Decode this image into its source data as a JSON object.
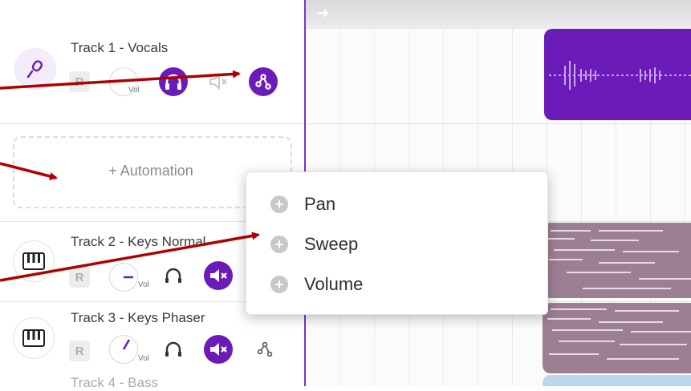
{
  "colors": {
    "accent": "#6a1bb8",
    "vocals_clip": "#6a1bb8",
    "keys_clip": "#9d7f94",
    "annotation_arrow": "#b00000"
  },
  "header": {
    "arrow_icon": "arrow-right-icon"
  },
  "tracks": [
    {
      "name": "Track 1 - Vocals",
      "icon": "microphone-icon",
      "record_label": "R",
      "vol_label": "Vol",
      "headphones_on": true,
      "muted": false,
      "automation_active": true
    },
    {
      "name": "Track 2 - Keys Normal",
      "icon": "piano-keys-icon",
      "record_label": "R",
      "vol_label": "Vol",
      "headphones_on": false,
      "muted": true,
      "automation_active": false
    },
    {
      "name": "Track 3 - Keys Phaser",
      "icon": "piano-keys-icon",
      "record_label": "R",
      "vol_label": "Vol",
      "headphones_on": false,
      "muted": true,
      "automation_active": false
    },
    {
      "name": "Track 4 - Bass"
    }
  ],
  "automation": {
    "add_label": "+ Automation"
  },
  "automation_menu": {
    "items": [
      {
        "label": "Pan",
        "icon": "plus-circle-icon"
      },
      {
        "label": "Sweep",
        "icon": "plus-circle-icon"
      },
      {
        "label": "Volume",
        "icon": "plus-circle-icon"
      }
    ]
  }
}
